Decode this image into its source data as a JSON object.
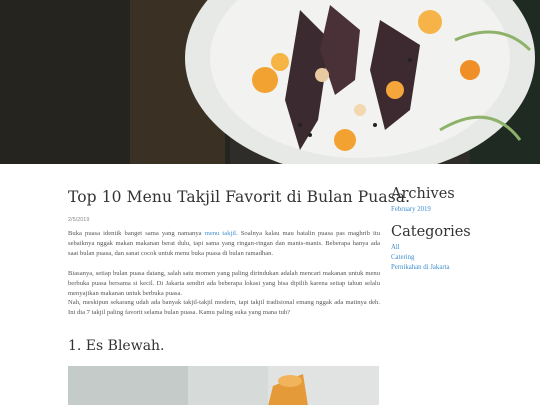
{
  "hero": {
    "image_icon": "food-plate-photo"
  },
  "post": {
    "title": "Top 10 Menu Takjil Favorit di Bulan Puasa.",
    "date": "2/5/2019",
    "intro": {
      "before_link": "Buka puasa identik banget sama yang namanya ",
      "link_text": "menu takjil",
      "after_link": ". Soalnya kalau mau batalin puasa pas maghrib itu sebaiknya nggak makan makanan berat dulu, tapi sama yang ringan-ringan dan manis-manis. Beberapa hanya ada saat bulan puasa, dan sanat cocok untuk menu buka puasa di bulan ramadhan."
    },
    "paragraph2": "Biasanya, setiap bulan puasa datang, salah satu momen yang paling dirindukan adalah mencari makanan untuk menu berbuka puasa bersama si kecil. Di Jakarta sendiri ada beberapa lokasi yang bisa dipilih karena setiap tahun selalu menyajikan makanan untuk berbuka puasa.",
    "paragraph3": " Nah, meskipun sekarang udah ada banyak takjil-takjil modern, tapi takjil tradisional emang nggak ada matinya deh. Ini dia 7 takjil paling favorit selama bulan puasa. Kamu paling suka yang mana tuh?",
    "section1_heading": "1. Es Blewah.",
    "section1_image_icon": "es-blewah-photo"
  },
  "sidebar": {
    "archives_heading": "Archives",
    "archives": [
      "February 2019"
    ],
    "categories_heading": "Categories",
    "categories": [
      "All",
      "Catering",
      "Pernikahan di Jakarta"
    ]
  }
}
